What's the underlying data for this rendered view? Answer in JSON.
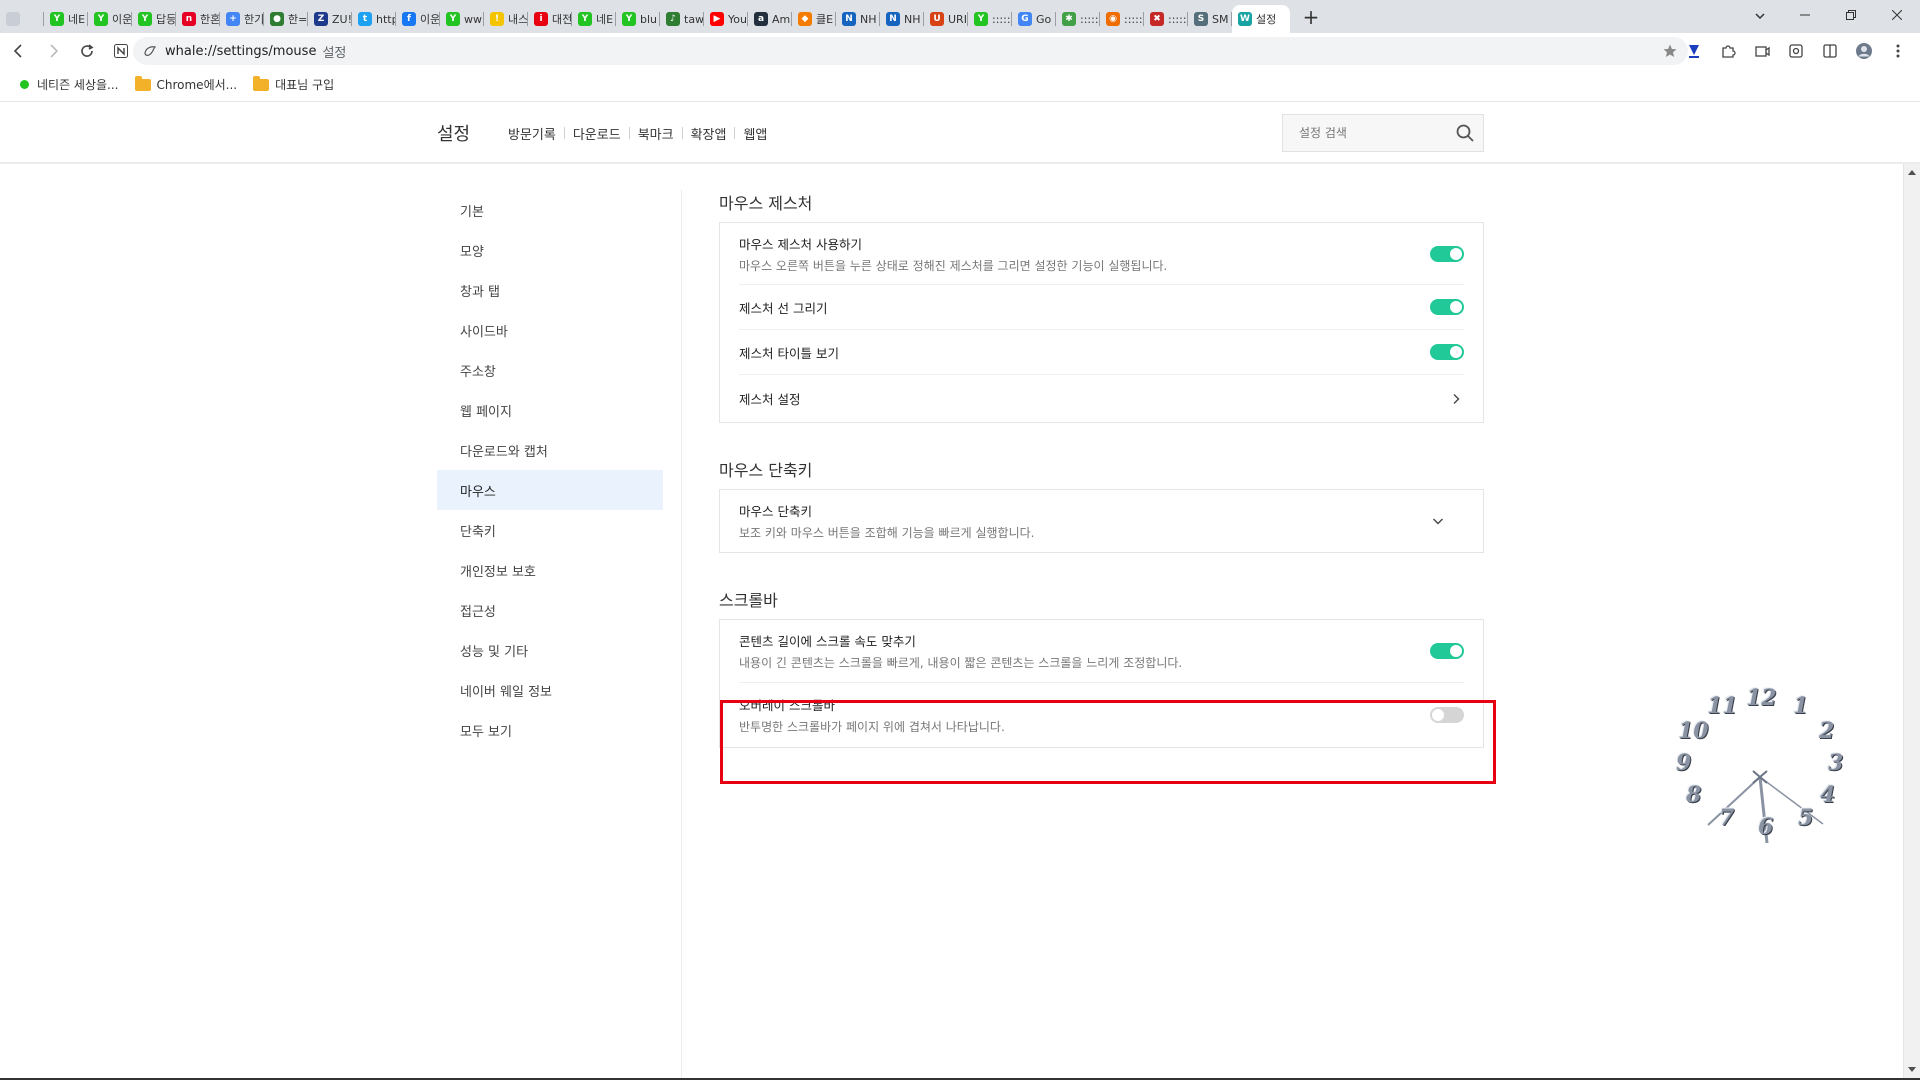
{
  "tabs": [
    {
      "label": "",
      "color": "#c9ced6",
      "glyph": ""
    },
    {
      "label": "네E",
      "color": "#21c421",
      "glyph": "Y"
    },
    {
      "label": "이운",
      "color": "#21c421",
      "glyph": "Y"
    },
    {
      "label": "답등",
      "color": "#21c421",
      "glyph": "Y"
    },
    {
      "label": "한혼",
      "color": "#e60023",
      "glyph": "n"
    },
    {
      "label": "한기",
      "color": "#4285f4",
      "glyph": "+"
    },
    {
      "label": "한=",
      "color": "#2e7d32",
      "glyph": "●"
    },
    {
      "label": "ZU!",
      "color": "#1e3a8a",
      "glyph": "Z"
    },
    {
      "label": "http",
      "color": "#1da1f2",
      "glyph": "t"
    },
    {
      "label": "이운",
      "color": "#1877f2",
      "glyph": "f"
    },
    {
      "label": "ww",
      "color": "#21c421",
      "glyph": "Y"
    },
    {
      "label": "내스",
      "color": "#f5c400",
      "glyph": "!"
    },
    {
      "label": "대전",
      "color": "#e60012",
      "glyph": "i"
    },
    {
      "label": "네E",
      "color": "#21c421",
      "glyph": "Y"
    },
    {
      "label": "blu",
      "color": "#21c421",
      "glyph": "Y"
    },
    {
      "label": "taw",
      "color": "#2e7d32",
      "glyph": "♪"
    },
    {
      "label": "You",
      "color": "#ff0000",
      "glyph": "▶"
    },
    {
      "label": "Am",
      "color": "#232f3e",
      "glyph": "a"
    },
    {
      "label": "클E",
      "color": "#f57c00",
      "glyph": "◆"
    },
    {
      "label": "NH",
      "color": "#1565c0",
      "glyph": "N"
    },
    {
      "label": "NH",
      "color": "#1565c0",
      "glyph": "N"
    },
    {
      "label": "URI",
      "color": "#d84315",
      "glyph": "U"
    },
    {
      "label": ":::::",
      "color": "#21c421",
      "glyph": "Y"
    },
    {
      "label": "Go",
      "color": "#4285f4",
      "glyph": "G"
    },
    {
      "label": ":::::",
      "color": "#43a047",
      "glyph": "✱"
    },
    {
      "label": ":::::",
      "color": "#ef6c00",
      "glyph": "◉"
    },
    {
      "label": ":::::",
      "color": "#c62828",
      "glyph": "✖"
    },
    {
      "label": "SM",
      "color": "#546e7a",
      "glyph": "S"
    },
    {
      "label": "설정",
      "color": "#1aa3a3",
      "glyph": "W",
      "active": true
    }
  ],
  "toolbar": {
    "url": "whale://settings/mouse",
    "url_hint": "설정"
  },
  "bookmarks": [
    {
      "label": "네티즌 세상을...",
      "type": "dot"
    },
    {
      "label": "Chrome에서...",
      "type": "folder"
    },
    {
      "label": "대표님 구입",
      "type": "folder"
    }
  ],
  "header": {
    "title": "설정",
    "nav": [
      "방문기록",
      "다운로드",
      "북마크",
      "확장앱",
      "웹앱"
    ],
    "search_placeholder": "설정 검색"
  },
  "sidebar": {
    "items": [
      {
        "label": "기본"
      },
      {
        "label": "모양"
      },
      {
        "label": "창과 탭"
      },
      {
        "label": "사이드바"
      },
      {
        "label": "주소창"
      },
      {
        "label": "웹 페이지"
      },
      {
        "label": "다운로드와 캡처"
      },
      {
        "label": "마우스",
        "active": true
      },
      {
        "label": "단축키"
      },
      {
        "label": "개인정보 보호"
      },
      {
        "label": "접근성"
      },
      {
        "label": "성능 및 기타"
      },
      {
        "label": "네이버 웨일 정보"
      },
      {
        "label": "모두 보기"
      }
    ]
  },
  "sections": {
    "gesture": {
      "title": "마우스 제스처",
      "enable_label": "마우스 제스처 사용하기",
      "enable_desc": "마우스 오른쪽 버튼을 누른 상태로 정해진 제스처를 그리면 설정한 기능이 실행됩니다.",
      "enable_on": true,
      "line_label": "제스처 선 그리기",
      "line_on": true,
      "title_label": "제스처 타이틀 보기",
      "title_on": true,
      "settings_label": "제스처 설정"
    },
    "shortcut": {
      "title": "마우스 단축키",
      "label": "마우스 단축키",
      "desc": "보조 키와 마우스 버튼을 조합해 기능을 빠르게 실행합니다."
    },
    "scrollbar": {
      "title": "스크롤바",
      "speed_label": "콘텐츠 길이에 스크롤 속도 맞추기",
      "speed_desc": "내용이 긴 콘텐츠는 스크롤을 빠르게, 내용이 짧은 콘텐츠는 스크롤을 느리게 조정합니다.",
      "speed_on": true,
      "overlay_label": "오버레이 스크롤바",
      "overlay_desc": "반투명한 스크롤바가 페이지 위에 겹쳐서 나타납니다.",
      "overlay_on": false
    }
  },
  "clock": {
    "numbers": [
      "12",
      "1",
      "2",
      "3",
      "4",
      "5",
      "6",
      "7",
      "8",
      "9",
      "10",
      "11"
    ]
  },
  "colors": {
    "toggle_on": "#20c997",
    "toggle_off": "#d5d5d5",
    "highlight": "#e60012",
    "active_bg": "#eaf3fd"
  }
}
